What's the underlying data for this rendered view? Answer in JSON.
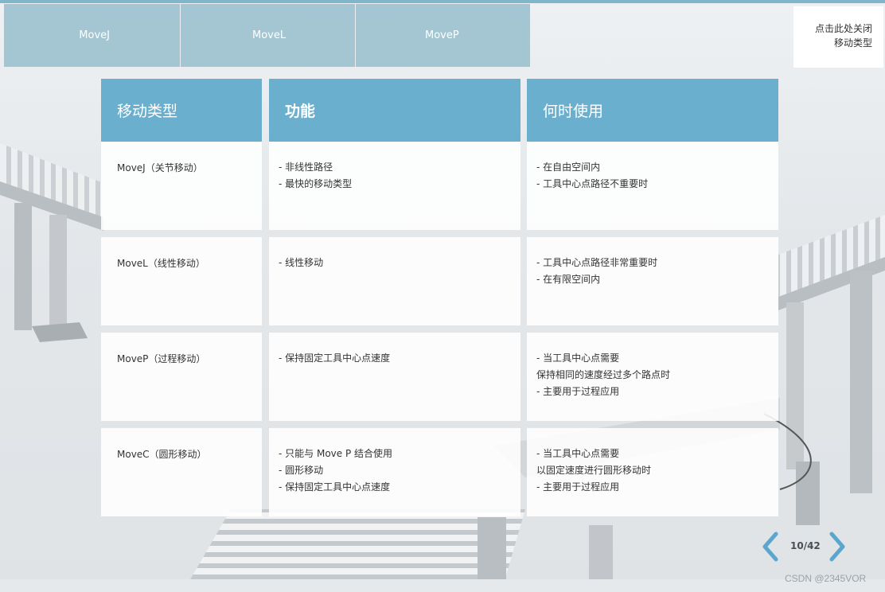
{
  "tabs": [
    {
      "label": "MoveJ"
    },
    {
      "label": "MoveL"
    },
    {
      "label": "MoveP"
    }
  ],
  "close_panel": {
    "line1": "点击此处关闭",
    "line2": "移动类型"
  },
  "table": {
    "headers": [
      "移动类型",
      "功能",
      "何时使用"
    ],
    "rows": [
      {
        "type": "MoveJ（关节移动）",
        "function": [
          "- 非线性路径",
          "- 最快的移动类型"
        ],
        "when": [
          "- 在自由空间内",
          "- 工具中心点路径不重要时"
        ]
      },
      {
        "type": "MoveL（线性移动）",
        "function": [
          "- 线性移动"
        ],
        "when": [
          "- 工具中心点路径非常重要时",
          "- 在有限空间内"
        ]
      },
      {
        "type": "MoveP（过程移动）",
        "function": [
          "- 保持固定工具中心点速度"
        ],
        "when": [
          "- 当工具中心点需要",
          "保持相同的速度经过多个路点时",
          "- 主要用于过程应用"
        ]
      },
      {
        "type": "MoveC（圆形移动）",
        "function": [
          "- 只能与 Move P 结合使用",
          "- 圆形移动",
          "- 保持固定工具中心点速度"
        ],
        "when": [
          "- 当工具中心点需要",
          "以固定速度进行圆形移动时",
          "- 主要用于过程应用"
        ]
      }
    ]
  },
  "pager": {
    "current": 10,
    "total": 42,
    "text": "10/42",
    "prev_icon": "chevron-left-icon",
    "next_icon": "chevron-right-icon"
  },
  "watermark": "CSDN @2345VOR",
  "colors": {
    "accent": "#6ab0ce",
    "tab_bg": "#8fbacb",
    "arrow": "#5aa6cc"
  }
}
